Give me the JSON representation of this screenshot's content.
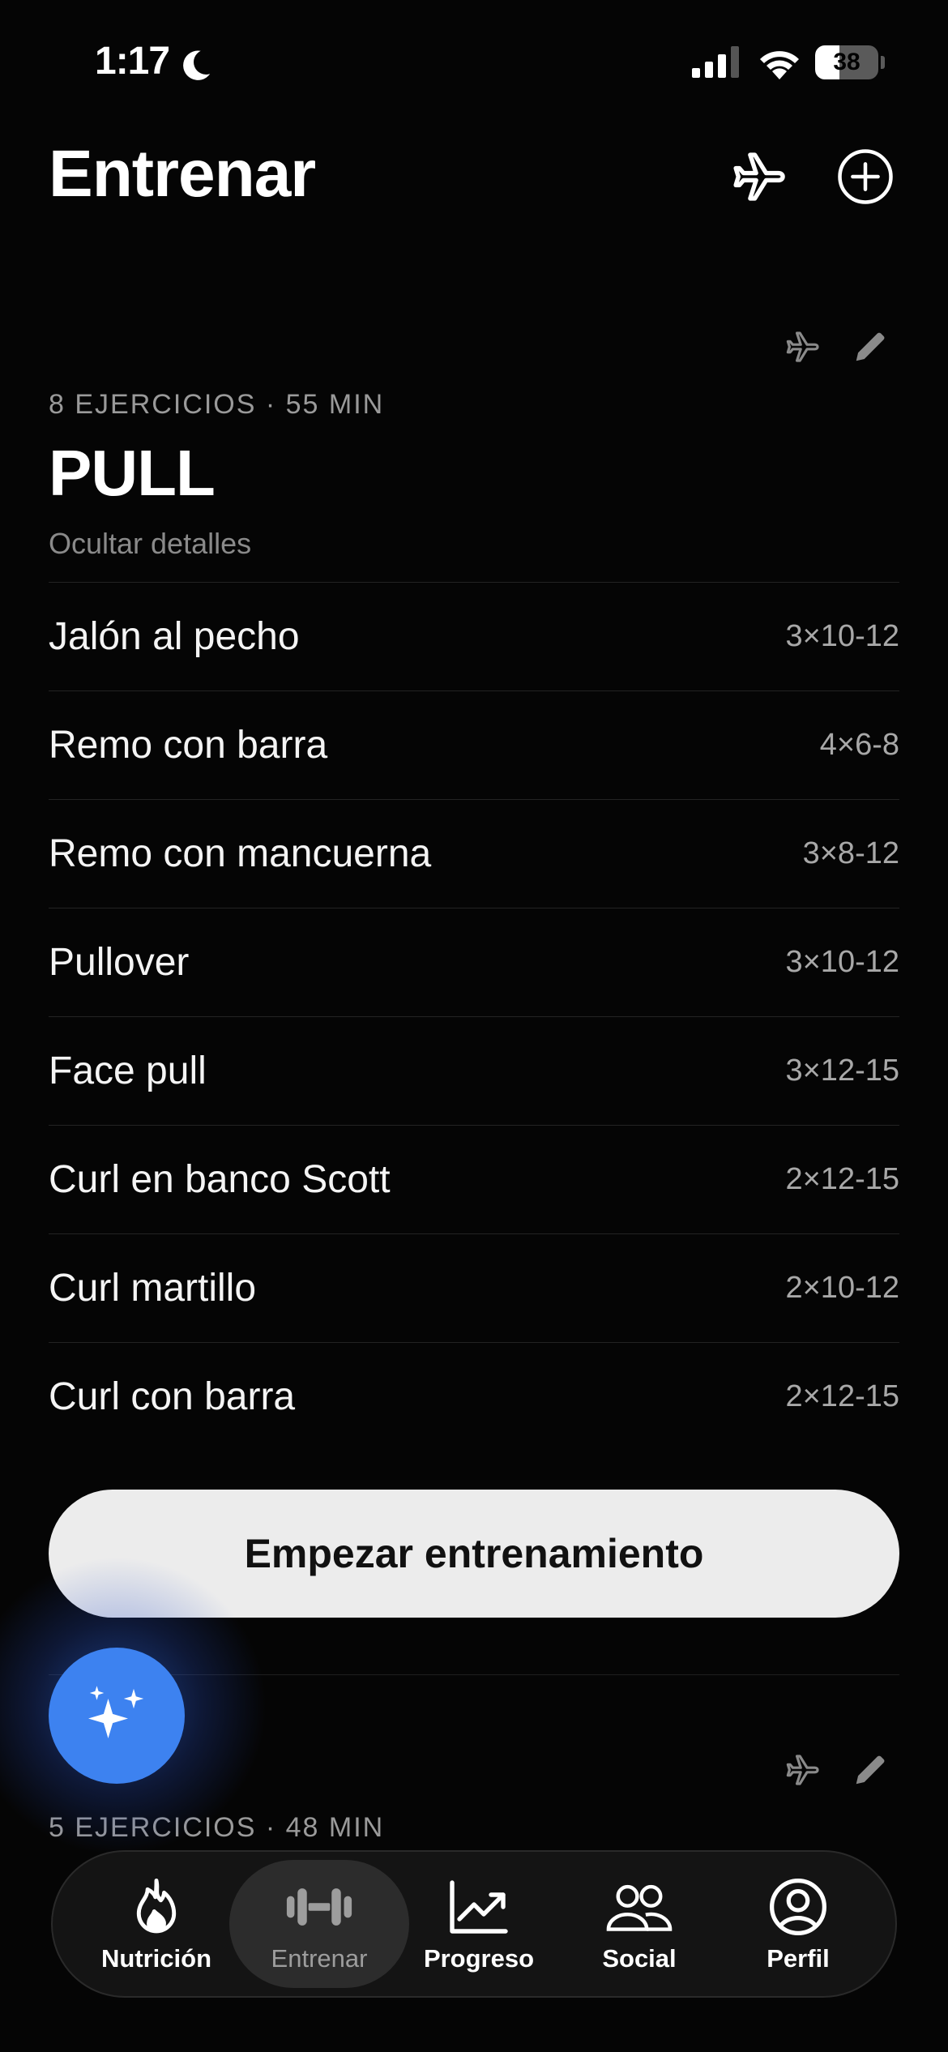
{
  "status_bar": {
    "time": "1:17",
    "battery_level": "38",
    "battery_fraction": 0.38,
    "icons": [
      "moon-icon",
      "cellular-signal-icon",
      "wifi-icon",
      "battery-icon"
    ]
  },
  "header": {
    "title": "Entrenar",
    "icons": [
      "airplane-icon",
      "plus-circle-icon"
    ]
  },
  "routines": [
    {
      "meta": "8 EJERCICIOS · 55 MIN",
      "name": "PULL",
      "toggle_label": "Ocultar detalles",
      "exercises": [
        {
          "name": "Jalón al pecho",
          "sets": "3×10-12"
        },
        {
          "name": "Remo con barra",
          "sets": "4×6-8"
        },
        {
          "name": "Remo con mancuerna",
          "sets": "3×8-12"
        },
        {
          "name": "Pullover",
          "sets": "3×10-12"
        },
        {
          "name": "Face pull",
          "sets": "3×12-15"
        },
        {
          "name": "Curl en banco Scott",
          "sets": "2×12-15"
        },
        {
          "name": "Curl martillo",
          "sets": "2×10-12"
        },
        {
          "name": "Curl con barra",
          "sets": "2×12-15"
        }
      ],
      "start_label": "Empezar entrenamiento"
    },
    {
      "meta": "5 EJERCICIOS · 48 MIN"
    }
  ],
  "ai_button": {
    "icon": "sparkles-icon"
  },
  "tabbar": {
    "active": "Entrenar",
    "tabs": [
      {
        "label": "Nutrición",
        "icon": "flame-icon"
      },
      {
        "label": "Entrenar",
        "icon": "dumbbell-icon"
      },
      {
        "label": "Progreso",
        "icon": "chart-trend-icon"
      },
      {
        "label": "Social",
        "icon": "people-icon"
      },
      {
        "label": "Perfil",
        "icon": "person-circle-icon"
      }
    ]
  },
  "colors": {
    "background": "#050505",
    "accent_blue": "#3d82f0",
    "start_button": "#ececec",
    "muted_text": "#9a9a9a"
  }
}
